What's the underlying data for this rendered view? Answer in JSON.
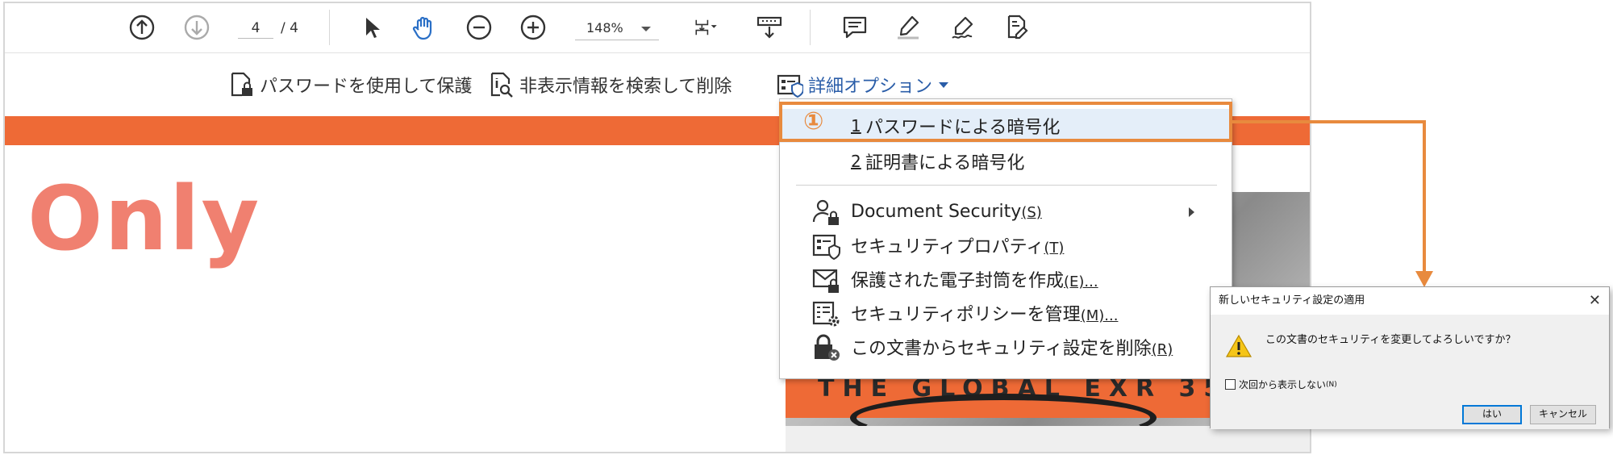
{
  "toolbar": {
    "page_current": "4",
    "page_total": "/ 4",
    "zoom": "148%",
    "buttons": [
      "prev-page-icon",
      "next-page-icon",
      "select-icon",
      "hand-icon",
      "zoom-out-icon",
      "zoom-in-icon",
      "fit-page-icon",
      "scroll-mode-icon",
      "comment-icon",
      "highlight-icon",
      "sign-icon",
      "fill-sign-icon"
    ]
  },
  "protect_bar": {
    "password_protect": "パスワードを使用して保護",
    "find_remove_hidden": "非表示情報を検索して削除",
    "advanced_options": "詳細オプション"
  },
  "document": {
    "headline": "Only",
    "photo_caption": "THE GLOBAL EXR 35"
  },
  "menu": {
    "step_marker": "①",
    "items": [
      {
        "num": "1",
        "label": "パスワードによる暗号化"
      },
      {
        "num": "2",
        "label": "証明書による暗号化"
      },
      {
        "label": "Document Security",
        "access": "(S)"
      },
      {
        "label": "セキュリティプロパティ",
        "access": "(T)"
      },
      {
        "label": "保護された電子封筒を作成",
        "access": "(E)..."
      },
      {
        "label": "セキュリティポリシーを管理",
        "access": "(M)..."
      },
      {
        "label": "この文書からセキュリティ設定を削除",
        "access": "(R)"
      }
    ]
  },
  "dialog": {
    "title": "新しいセキュリティ設定の適用",
    "close": "✕",
    "message": "この文書のセキュリティを変更してよろしいですか？",
    "checkbox_label": "次回から表示しない",
    "checkbox_access": "(N)",
    "yes": "はい",
    "cancel": "キャンセル"
  },
  "colors": {
    "accent_orange": "#ee6a36",
    "callout": "#e88a3e",
    "link_blue": "#2a5da8",
    "headline": "#f08070"
  }
}
